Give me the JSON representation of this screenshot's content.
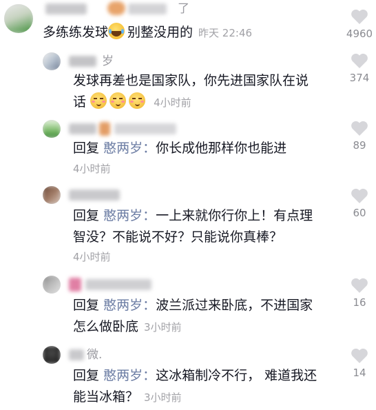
{
  "comments": [
    {
      "name_fragment": "了",
      "text": "多练练发球",
      "text_after_emoji": "别整没用的",
      "time": "昨天 22:46",
      "likes": "4960",
      "emoji": [
        "laugh-emoji"
      ]
    },
    {
      "name_fragment": "岁",
      "text_line1": "发球再差也是国家队，你先进国家队在说",
      "text_line2": "话",
      "time": "4小时前",
      "likes": "374",
      "emoji": [
        "sly-emoji",
        "sly-emoji",
        "sly-emoji"
      ]
    },
    {
      "reply_label": "回复",
      "mention": "憨两岁：",
      "text": "你长成他那样你也能进",
      "time": "4小时前",
      "likes": "89"
    },
    {
      "reply_label": "回复",
      "mention": "憨两岁：",
      "text_line1": "一上来就你行你上！有点理",
      "text_line2": "智没？不能说不好？只能说你真棒？",
      "time": "4小时前",
      "likes": "60"
    },
    {
      "reply_label": "回复",
      "mention": "憨两岁：",
      "text_line1": "波兰派过来卧底，不进国家",
      "text_line2": "怎么做卧底",
      "time": "3小时前",
      "likes": "16"
    },
    {
      "name_fragment": "微.",
      "reply_label": "回复",
      "mention": "憨两岁：",
      "text_line1": "这冰箱制冷不行， 难道我还",
      "text_line2": "能当冰箱？",
      "time": "3小时前",
      "likes": "14"
    }
  ],
  "colors": {
    "text": "#161823",
    "mention": "#6b7ca3",
    "meta": "#a1a1a6",
    "heart": "#d6d6da"
  }
}
